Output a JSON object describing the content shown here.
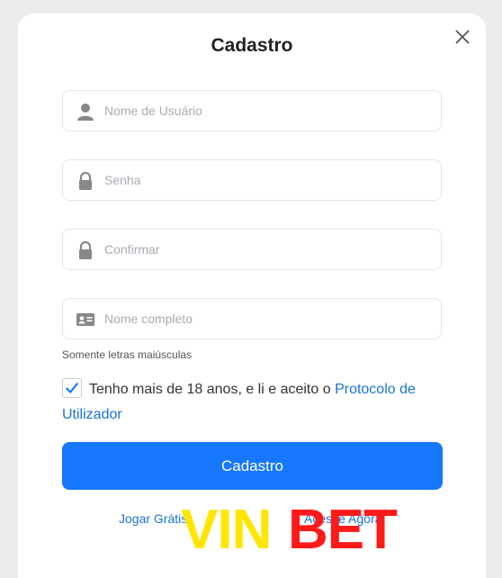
{
  "dialog": {
    "title": "Cadastro",
    "fields": {
      "username_placeholder": "Nome de Usuário",
      "password_placeholder": "Senha",
      "confirm_placeholder": "Confirmar",
      "fullname_placeholder": "Nome completo"
    },
    "hint": "Somente letras maiúsculas",
    "agreement": {
      "checked": true,
      "text": "Tenho mais de 18 anos, e li e aceito o ",
      "link": "Protocolo de Utilizador"
    },
    "submit_label": "Cadastro",
    "footer": {
      "left_link": "Jogar Grátis",
      "right_link": "Acesse Agora"
    }
  },
  "watermark": {
    "part1": "VIN",
    "part2": "BET",
    "color1": "#ffe600",
    "color2": "#ff1a1a"
  },
  "colors": {
    "accent": "#1677ff",
    "link": "#1a73d9"
  }
}
